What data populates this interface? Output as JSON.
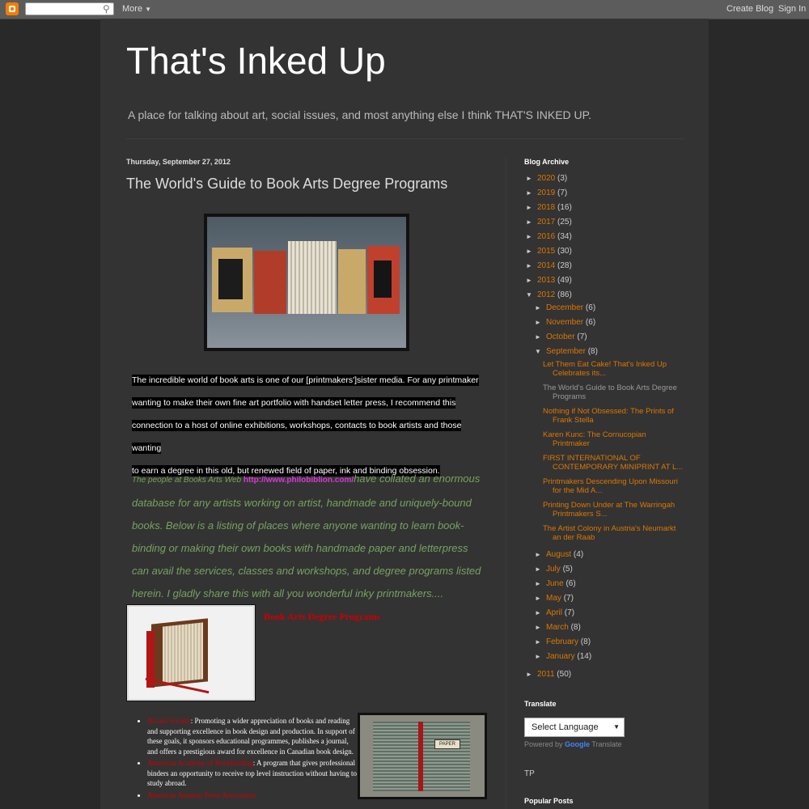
{
  "navbar": {
    "more": "More",
    "create_blog": "Create Blog",
    "sign_in": "Sign In"
  },
  "blog": {
    "title": "That's Inked Up",
    "description": "A place for talking about art, social issues, and most anything else I think THAT'S INKED UP."
  },
  "post": {
    "date": "Thursday, September 27, 2012",
    "title": "The World's Guide to Book Arts Degree Programs",
    "intro_lines": [
      "The incredible world of book arts is one of our [printmakers']sister media. For any printmaker",
      "wanting to make their own fine art portfolio with handset letter press, I recommend this",
      "connection to a host of online exhibitions, workshops, contacts to book artists and those wanting",
      "to earn a degree in this old, but renewed field of paper, ink and binding obsession."
    ],
    "people_prefix": "The people at Books Arts Web ",
    "people_link": "http://www.philobiblion.com/",
    "people_rest": "have collated an enormous database for any artists working on artist, handmade and uniquely-bound books. Below is a listing of places where anyone wanting to learn book-binding or making their own books with handmade paper and letterpress can avail the services, classes and workshops, and degree programs listed herein. I gladly share this with all you wonderful inky printmakers....",
    "degree_heading": "Book Arts Degree Programs",
    "list": [
      {
        "name": "Alcuin Society",
        "text": ": Promoting a wider appreciation of books and reading and supporting excellence in book design and production. In support of these goals, it sponsors educational programmes, publishes a journal, and offers a prestigious award for excellence in Canadian book design."
      },
      {
        "name": "American Academy of Bookbinding",
        "text": ": A program that gives professional binders an opportunity to receive top level instruction without having to study abroad."
      },
      {
        "name": "American Amateur Press Association",
        "text": ""
      }
    ],
    "paper_label": "PAPER"
  },
  "sidebar": {
    "archive_heading": "Blog Archive",
    "years": [
      {
        "year": "2020",
        "count": "(3)",
        "open": false
      },
      {
        "year": "2019",
        "count": "(7)",
        "open": false
      },
      {
        "year": "2018",
        "count": "(16)",
        "open": false
      },
      {
        "year": "2017",
        "count": "(25)",
        "open": false
      },
      {
        "year": "2016",
        "count": "(34)",
        "open": false
      },
      {
        "year": "2015",
        "count": "(30)",
        "open": false
      },
      {
        "year": "2014",
        "count": "(28)",
        "open": false
      },
      {
        "year": "2013",
        "count": "(49)",
        "open": false
      },
      {
        "year": "2012",
        "count": "(86)",
        "open": true
      }
    ],
    "months_before": [
      {
        "month": "December",
        "count": "(6)"
      },
      {
        "month": "November",
        "count": "(6)"
      },
      {
        "month": "October",
        "count": "(7)"
      },
      {
        "month": "September",
        "count": "(8)"
      }
    ],
    "september_posts": [
      [
        "Let Them Eat Cake! That's Inked Up",
        "Celebrates its..."
      ],
      [
        "The World's Guide to Book Arts Degree",
        "Programs"
      ],
      [
        "Nothing if Not Obsessed: The Prints of",
        "Frank Stella"
      ],
      [
        "Karen Kunc: The Cornucopian",
        "Printmaker"
      ],
      [
        "FIRST INTERNATIONAL OF",
        "CONTEMPORARY MINIPRINT AT L..."
      ],
      [
        "Printmakers Descending Upon Missouri",
        "for the Mid A..."
      ],
      [
        "Printing Down Under at The Warringah",
        "Printmakers S..."
      ],
      [
        "The Artist Colony in Austria's Neumarkt",
        "an der Raab"
      ]
    ],
    "months_after": [
      {
        "month": "August",
        "count": "(4)"
      },
      {
        "month": "July",
        "count": "(5)"
      },
      {
        "month": "June",
        "count": "(6)"
      },
      {
        "month": "May",
        "count": "(7)"
      },
      {
        "month": "April",
        "count": "(7)"
      },
      {
        "month": "March",
        "count": "(8)"
      },
      {
        "month": "February",
        "count": "(8)"
      },
      {
        "month": "January",
        "count": "(14)"
      }
    ],
    "year_2011": {
      "year": "2011",
      "count": "(50)"
    },
    "translate_heading": "Translate",
    "translate_select": "Select Language",
    "powered_by": "Powered by ",
    "google": "Google",
    "translate_word": " Translate",
    "tp": "TP",
    "popular_heading": "Popular Posts"
  },
  "colors": {
    "accent_link": "#dd7700",
    "degree_red": "#cc0000",
    "italic_green": "#77a35e",
    "link_magenta": "#d63ad6"
  }
}
